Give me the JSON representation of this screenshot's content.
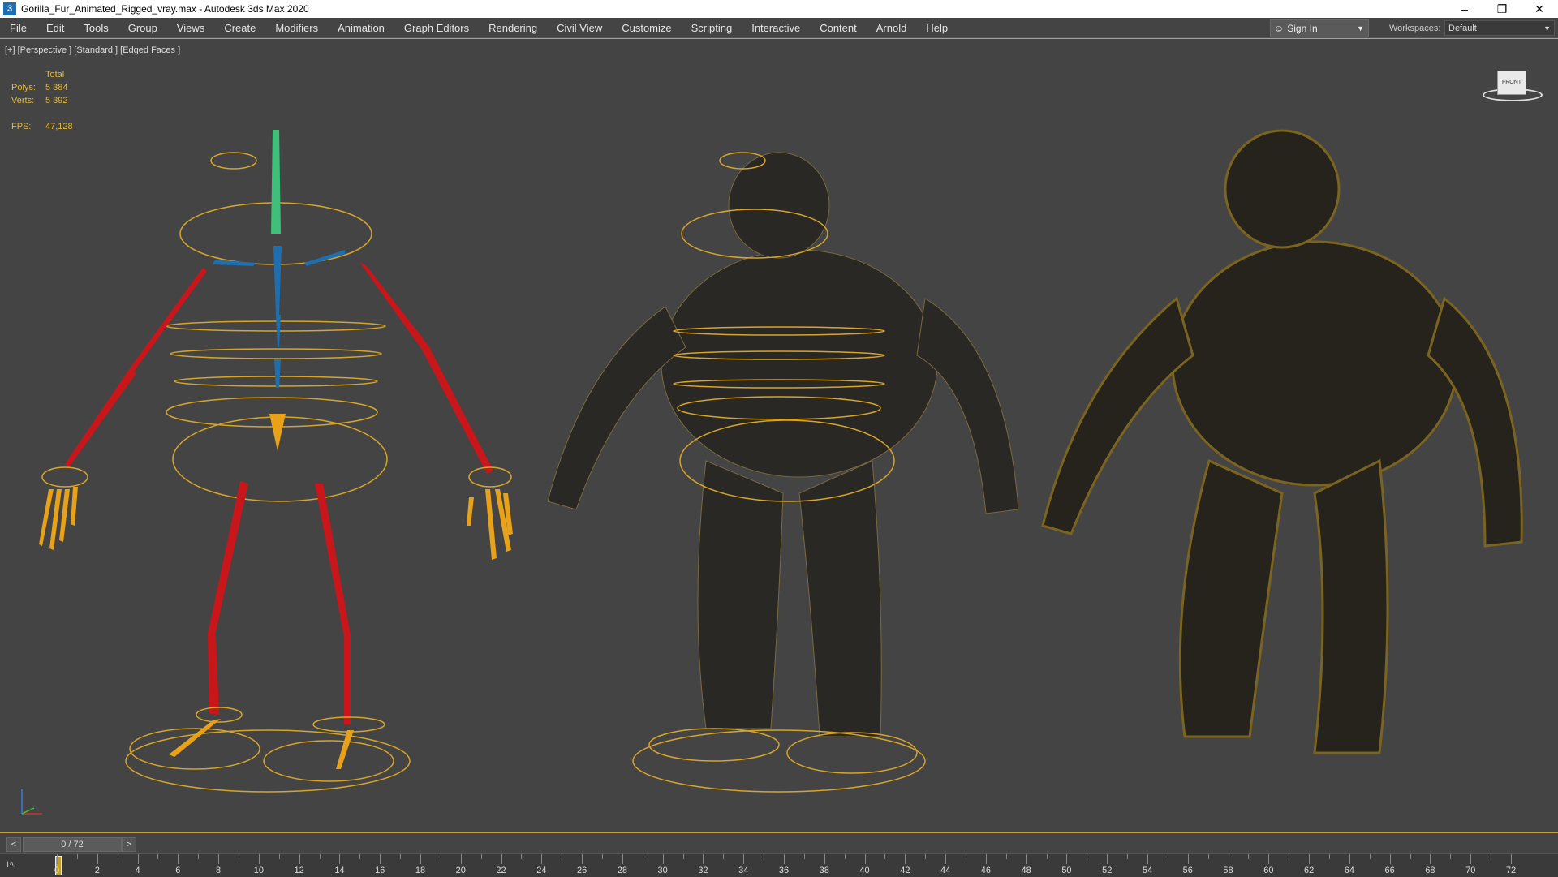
{
  "window": {
    "title": "Gorilla_Fur_Animated_Rigged_vray.max - Autodesk 3ds Max 2020",
    "app_icon": "3",
    "minimize_glyph": "–",
    "restore_glyph": "❐",
    "close_glyph": "✕"
  },
  "menu": [
    "File",
    "Edit",
    "Tools",
    "Group",
    "Views",
    "Create",
    "Modifiers",
    "Animation",
    "Graph Editors",
    "Rendering",
    "Civil View",
    "Customize",
    "Scripting",
    "Interactive",
    "Content",
    "Arnold",
    "Help"
  ],
  "account": {
    "sign_in": "Sign In"
  },
  "workspace": {
    "label": "Workspaces:",
    "value": "Default"
  },
  "viewport": {
    "label": "[+] [Perspective ] [Standard ] [Edged Faces ]",
    "stats": {
      "header": "Total",
      "polys_label": "Polys:",
      "polys_value": "5 384",
      "verts_label": "Verts:",
      "verts_value": "5 392",
      "fps_label": "FPS:",
      "fps_value": "47,128"
    },
    "viewcube_label": "FRONT"
  },
  "timeslider": {
    "frame": "0 / 72",
    "prev": "<",
    "next": ">"
  },
  "trackbar": {
    "curve_button": "I∿",
    "labels": [
      0,
      2,
      4,
      6,
      8,
      10,
      12,
      14,
      16,
      18,
      20,
      22,
      24,
      26,
      28,
      30,
      32,
      34,
      36,
      38,
      40,
      42,
      44,
      46,
      48,
      50,
      52,
      54,
      56,
      58,
      60,
      62,
      64,
      66,
      68,
      70,
      72
    ]
  },
  "colors": {
    "accent": "#c9a23a",
    "bone_red": "#c8161a",
    "bone_blue": "#1e6fb0",
    "bone_orange": "#e8a21a",
    "bone_green": "#3fbf7a"
  }
}
